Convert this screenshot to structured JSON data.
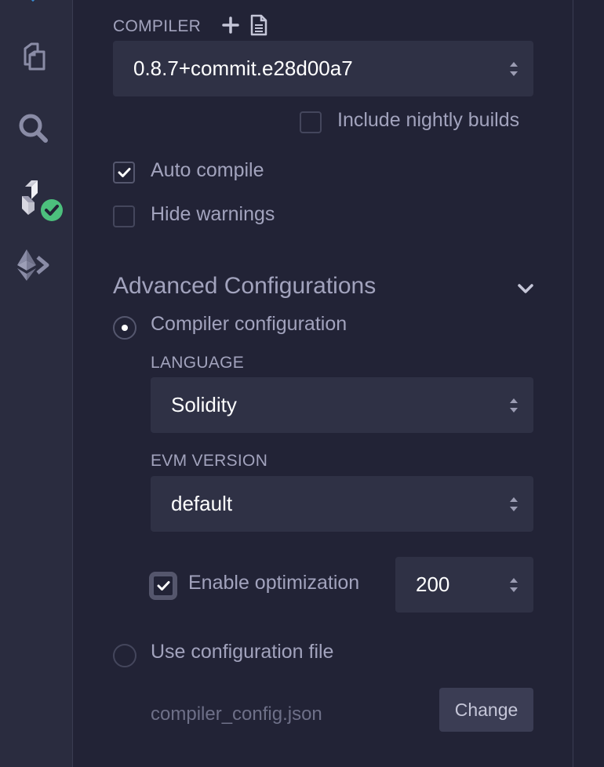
{
  "sidebar": {
    "icons": [
      "chevron-up-icon",
      "file-explorer-icon",
      "search-icon",
      "solidity-compiler-icon",
      "deploy-run-icon"
    ],
    "success_badge_color": "#4cc07d"
  },
  "compiler": {
    "label": "COMPILER",
    "version": "0.8.7+commit.e28d00a7",
    "nightly_label": "Include nightly builds",
    "nightly_checked": false
  },
  "options": {
    "auto_compile_label": "Auto compile",
    "auto_compile_checked": true,
    "hide_warnings_label": "Hide warnings",
    "hide_warnings_checked": false
  },
  "advanced": {
    "title": "Advanced Configurations",
    "compiler_config_label": "Compiler configuration",
    "compiler_config_selected": true,
    "language_label": "LANGUAGE",
    "language_value": "Solidity",
    "evm_label": "EVM VERSION",
    "evm_value": "default",
    "optimization_label": "Enable optimization",
    "optimization_checked": true,
    "runs_value": "200",
    "config_file_label": "Use configuration file",
    "config_file_selected": false,
    "config_file_name": "compiler_config.json",
    "change_button": "Change"
  },
  "colors": {
    "background": "#222336",
    "sidebar": "#2a2c3f",
    "input": "#2f3145",
    "text": "#a2a3bd",
    "text_bright": "#ffffff"
  }
}
